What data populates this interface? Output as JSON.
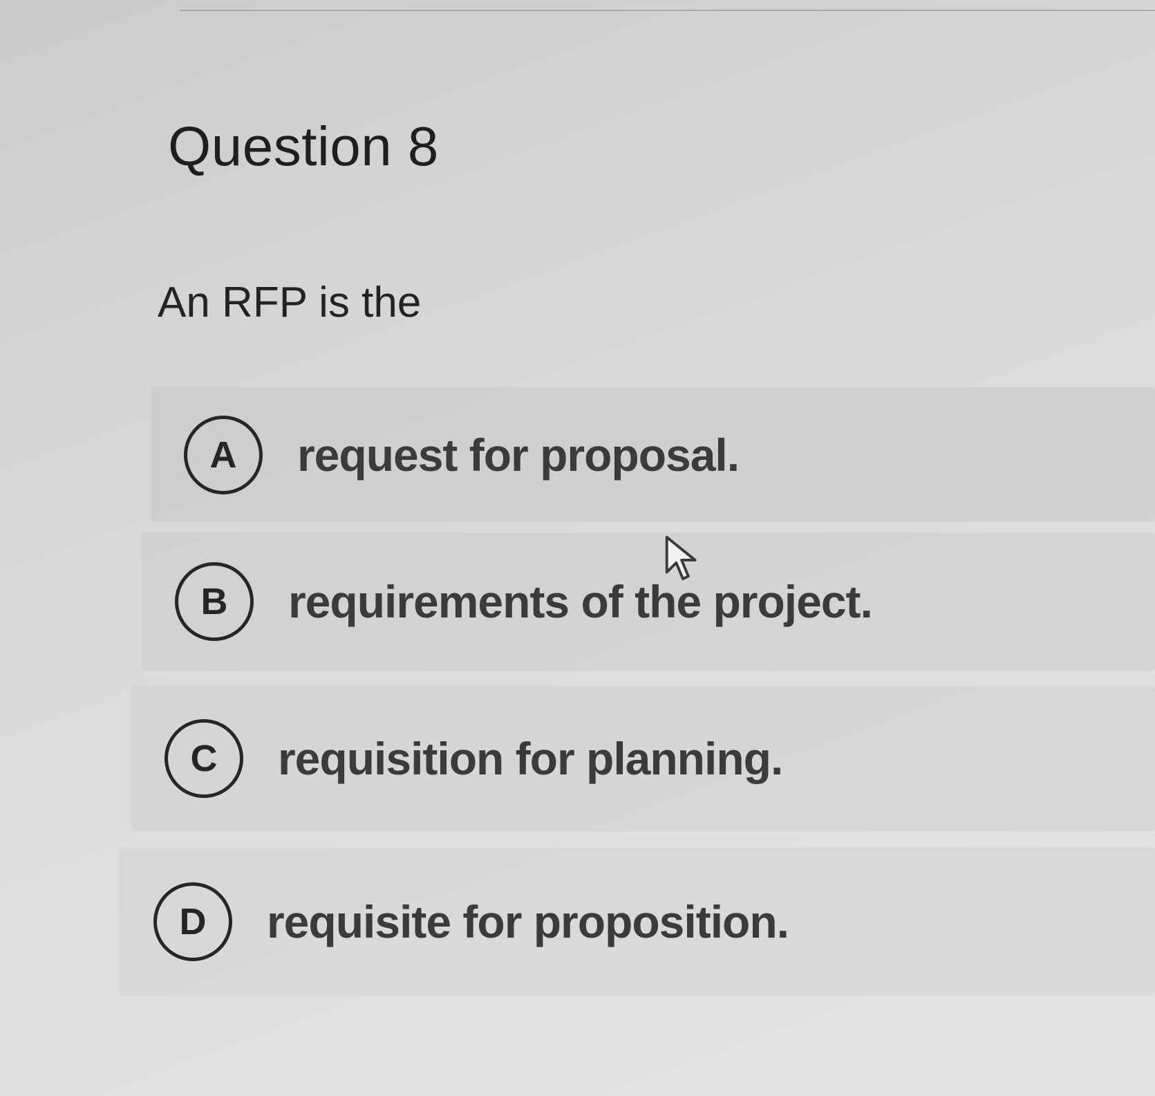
{
  "question": {
    "title": "Question 8",
    "prompt": "An RFP is the"
  },
  "options": [
    {
      "letter": "A",
      "text": "request for proposal."
    },
    {
      "letter": "B",
      "text": "requirements of the project."
    },
    {
      "letter": "C",
      "text": "requisition for planning."
    },
    {
      "letter": "D",
      "text": "requisite for proposition."
    }
  ],
  "cursor": {
    "icon": "mouse-pointer-icon"
  }
}
